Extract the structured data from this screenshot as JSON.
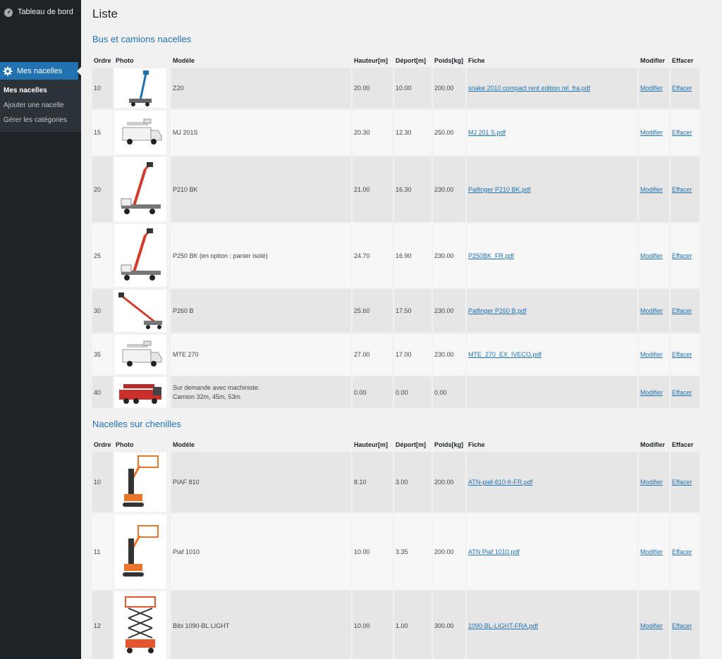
{
  "sidebar": {
    "dashboard": "Tableau de bord",
    "active_menu": "Mes nacelles",
    "submenu": [
      "Mes nacelles",
      "Ajouter une nacelle",
      "Gérer les catégories"
    ]
  },
  "page_title": "Liste",
  "columns": [
    "Ordre",
    "Photo",
    "Modèle",
    "Hauteur[m]",
    "Déport[m]",
    "Poids[kg]",
    "Fiche",
    "Modifier",
    "Effacer"
  ],
  "actions": {
    "edit": "Modifier",
    "delete": "Effacer"
  },
  "sections": [
    {
      "title": "Bus et camions nacelles",
      "rows": [
        {
          "order": "10",
          "model": "Z20",
          "height": "20.00",
          "reach": "10.00",
          "weight": "200.00",
          "file": "snake 2010 compact rent edition rel_fra.pdf",
          "photo": "boom-lift-truck-icon"
        },
        {
          "order": "15",
          "model": "MJ 201S",
          "height": "20.30",
          "reach": "12.30",
          "weight": "250.00",
          "file": "MJ 201 S.pdf",
          "photo": "van-lift-icon"
        },
        {
          "order": "20",
          "model": "P210 BK",
          "height": "21.00",
          "reach": "16.30",
          "weight": "230.00",
          "file": "Palfinger P210 BK.pdf",
          "photo": "truck-boom-icon"
        },
        {
          "order": "25",
          "model": "P250 BK (en option : panier isolé)",
          "height": "24.70",
          "reach": "16.90",
          "weight": "230.00",
          "file": "P250BK_FR.pdf",
          "photo": "truck-boom-icon"
        },
        {
          "order": "30",
          "model": "P260 B",
          "height": "25.60",
          "reach": "17.50",
          "weight": "230.00",
          "file": "Palfinger P260 B.pdf",
          "photo": "truck-extended-boom-icon"
        },
        {
          "order": "35",
          "model": "MTE 270",
          "height": "27.00",
          "reach": "17.00",
          "weight": "230.00",
          "file": "MTE_270_EX_IVECO.pdf",
          "photo": "van-lift-icon"
        },
        {
          "order": "40",
          "model_line1": "Sur demande avec machiniste.",
          "model_line2": "Camion 32m, 45m, 53m",
          "height": "0.00",
          "reach": "0.00",
          "weight": "0.00",
          "file": "",
          "photo": "red-crane-truck-icon"
        }
      ]
    },
    {
      "title": "Nacelles sur chenilles",
      "rows": [
        {
          "order": "10",
          "model": "PIAF 810",
          "height": "8.10",
          "reach": "3.00",
          "weight": "200.00",
          "file": "ATN-piaf-810-fr-FR.pdf",
          "photo": "tracked-mast-lift-icon"
        },
        {
          "order": "11",
          "model": "Piaf 1010",
          "height": "10.00",
          "reach": "3.35",
          "weight": "200.00",
          "file": "ATN Piaf 1010.pdf",
          "photo": "tracked-mast-lift-icon"
        },
        {
          "order": "12",
          "model": "Bibi 1090-BL LIGHT",
          "height": "10.00",
          "reach": "1.00",
          "weight": "300.00",
          "file": "1090-BL-LIGHT-FRA.pdf",
          "photo": "scissor-lift-icon"
        }
      ]
    }
  ],
  "colors": {
    "sidebar": "#1e2327",
    "accent": "#2271b1",
    "link": "#2271b1"
  }
}
